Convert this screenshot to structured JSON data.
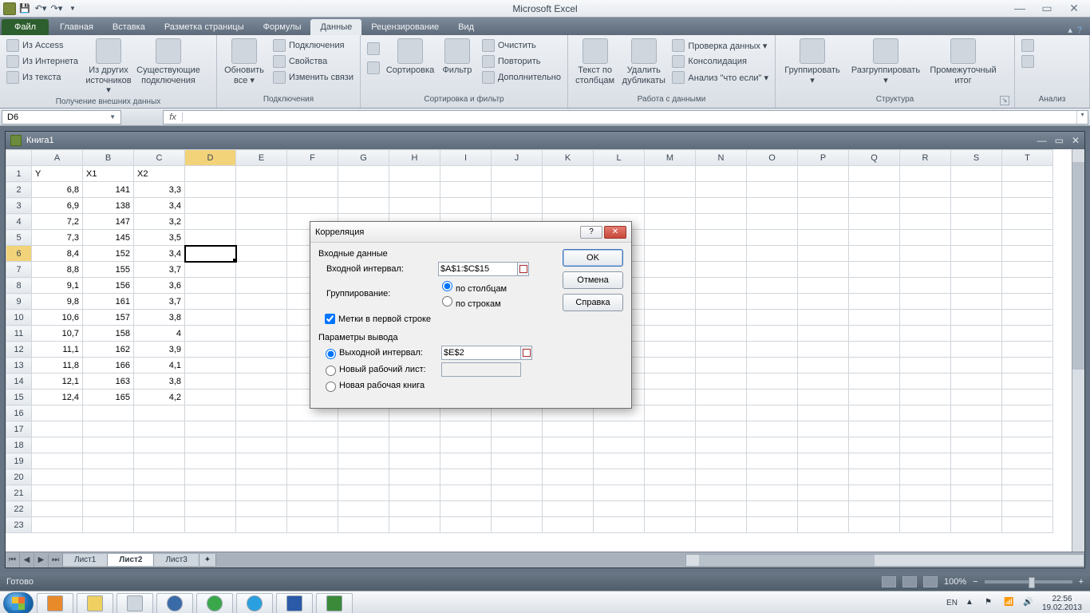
{
  "app_title": "Microsoft Excel",
  "qat": {
    "save": "save",
    "undo": "undo",
    "redo": "redo"
  },
  "tabs": {
    "file": "Файл",
    "items": [
      "Главная",
      "Вставка",
      "Разметка страницы",
      "Формулы",
      "Данные",
      "Рецензирование",
      "Вид"
    ],
    "active_index": 4
  },
  "ribbon": {
    "groups": [
      {
        "name": "Получение внешних данных",
        "items": [
          "Из Access",
          "Из Интернета",
          "Из текста"
        ],
        "big": [
          {
            "l1": "Из других",
            "l2": "источников ▾"
          },
          {
            "l1": "Существующие",
            "l2": "подключения"
          }
        ]
      },
      {
        "name": "Подключения",
        "big": [
          {
            "l1": "Обновить",
            "l2": "все ▾"
          }
        ],
        "items": [
          "Подключения",
          "Свойства",
          "Изменить связи"
        ]
      },
      {
        "name": "Сортировка и фильтр",
        "big": [
          {
            "l1": "А↓",
            "l2": "Я↑"
          },
          {
            "l1": "Сортировка",
            "l2": ""
          },
          {
            "l1": "Фильтр",
            "l2": ""
          }
        ],
        "items": [
          "Очистить",
          "Повторить",
          "Дополнительно"
        ]
      },
      {
        "name": "Работа с данными",
        "big": [
          {
            "l1": "Текст по",
            "l2": "столбцам"
          },
          {
            "l1": "Удалить",
            "l2": "дубликаты"
          }
        ],
        "items": [
          "Проверка данных ▾",
          "Консолидация",
          "Анализ \"что если\" ▾"
        ]
      },
      {
        "name": "Структура",
        "big": [
          {
            "l1": "Группировать",
            "l2": "▾"
          },
          {
            "l1": "Разгруппировать",
            "l2": "▾"
          },
          {
            "l1": "Промежуточный",
            "l2": "итог"
          }
        ],
        "items": []
      },
      {
        "name": "Анализ",
        "big": [],
        "items": []
      }
    ]
  },
  "namebox": "D6",
  "formula": "",
  "workbook": {
    "title": "Книга1",
    "cols": [
      "A",
      "B",
      "C",
      "D",
      "E",
      "F",
      "G",
      "H",
      "I",
      "J",
      "K",
      "L",
      "M",
      "N",
      "O",
      "P",
      "Q",
      "R",
      "S",
      "T"
    ],
    "rows": 23,
    "headers": {
      "A": "Y",
      "B": "X1",
      "C": "X2"
    },
    "data": [
      {
        "A": "6,8",
        "B": "141",
        "C": "3,3"
      },
      {
        "A": "6,9",
        "B": "138",
        "C": "3,4"
      },
      {
        "A": "7,2",
        "B": "147",
        "C": "3,2"
      },
      {
        "A": "7,3",
        "B": "145",
        "C": "3,5"
      },
      {
        "A": "8,4",
        "B": "152",
        "C": "3,4"
      },
      {
        "A": "8,8",
        "B": "155",
        "C": "3,7"
      },
      {
        "A": "9,1",
        "B": "156",
        "C": "3,6"
      },
      {
        "A": "9,8",
        "B": "161",
        "C": "3,7"
      },
      {
        "A": "10,6",
        "B": "157",
        "C": "3,8"
      },
      {
        "A": "10,7",
        "B": "158",
        "C": "4"
      },
      {
        "A": "11,1",
        "B": "162",
        "C": "3,9"
      },
      {
        "A": "11,8",
        "B": "166",
        "C": "4,1"
      },
      {
        "A": "12,1",
        "B": "163",
        "C": "3,8"
      },
      {
        "A": "12,4",
        "B": "165",
        "C": "4,2"
      }
    ],
    "selected": {
      "row": 6,
      "col": "D"
    },
    "sheets": [
      "Лист1",
      "Лист2",
      "Лист3"
    ],
    "active_sheet": 1
  },
  "dialog": {
    "title": "Корреляция",
    "section_input": "Входные данные",
    "lbl_range": "Входной интервал:",
    "val_range": "$A$1:$C$15",
    "lbl_group": "Группирование:",
    "opt_cols": "по столбцам",
    "opt_rows": "по строкам",
    "chk_labels": "Метки в первой строке",
    "chk_labels_checked": true,
    "section_output": "Параметры вывода",
    "opt_out_range": "Выходной интервал:",
    "val_out_range": "$E$2",
    "opt_new_sheet": "Новый рабочий лист:",
    "opt_new_book": "Новая рабочая книга",
    "btn_ok": "OK",
    "btn_cancel": "Отмена",
    "btn_help": "Справка"
  },
  "statusbar": {
    "ready": "Готово",
    "zoom": "100%"
  },
  "taskbar": {
    "lang": "EN",
    "time": "22:56",
    "date": "19.02.2013"
  }
}
